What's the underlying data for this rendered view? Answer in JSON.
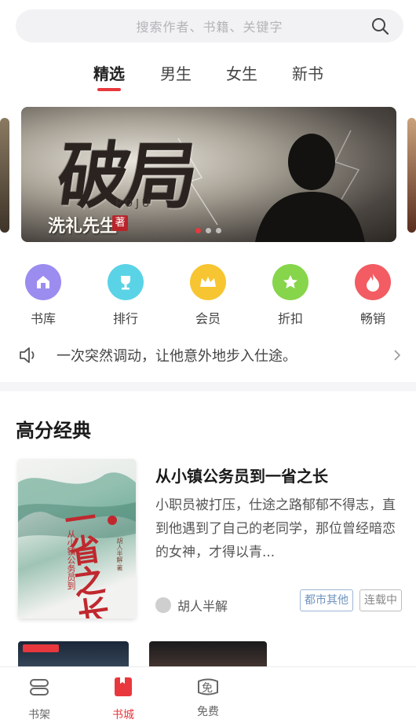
{
  "search": {
    "placeholder": "搜索作者、书籍、关键字"
  },
  "tabs": [
    {
      "label": "精选",
      "active": true
    },
    {
      "label": "男生"
    },
    {
      "label": "女生"
    },
    {
      "label": "新书"
    }
  ],
  "banner": {
    "title": "破局",
    "subtitle": "POJU",
    "author": "洗礼先生",
    "seal": "著"
  },
  "nav": [
    {
      "label": "书库",
      "icon": "house-icon",
      "color": "#9b8cf0"
    },
    {
      "label": "排行",
      "icon": "trophy-icon",
      "color": "#5ad3e6"
    },
    {
      "label": "会员",
      "icon": "crown-icon",
      "color": "#f7c531"
    },
    {
      "label": "折扣",
      "icon": "star-icon",
      "color": "#86d54b"
    },
    {
      "label": "畅销",
      "icon": "flame-icon",
      "color": "#f35c62"
    }
  ],
  "notice": {
    "text": "一次突然调动，让他意外地步入仕途。"
  },
  "section": {
    "title": "高分经典"
  },
  "book": {
    "title": "从小镇公务员到一省之长",
    "description": "小职员被打压，仕途之路郁郁不得志，直到他遇到了自己的老同学，那位曾经暗恋的女神，才得以青...",
    "author": "胡人半解",
    "tags": [
      "都市其他",
      "连载中"
    ],
    "cover": {
      "big": "一省之长",
      "vertical": "从小镇公务员到",
      "author_small": "胡人半解·著"
    }
  },
  "bottom_nav": [
    {
      "label": "书架",
      "icon": "bookshelf-icon"
    },
    {
      "label": "书城",
      "icon": "bookstore-icon",
      "active": true
    },
    {
      "label": "免费",
      "icon": "free-icon",
      "icon_text": "免"
    }
  ],
  "colors": {
    "accent": "#e8383d"
  }
}
